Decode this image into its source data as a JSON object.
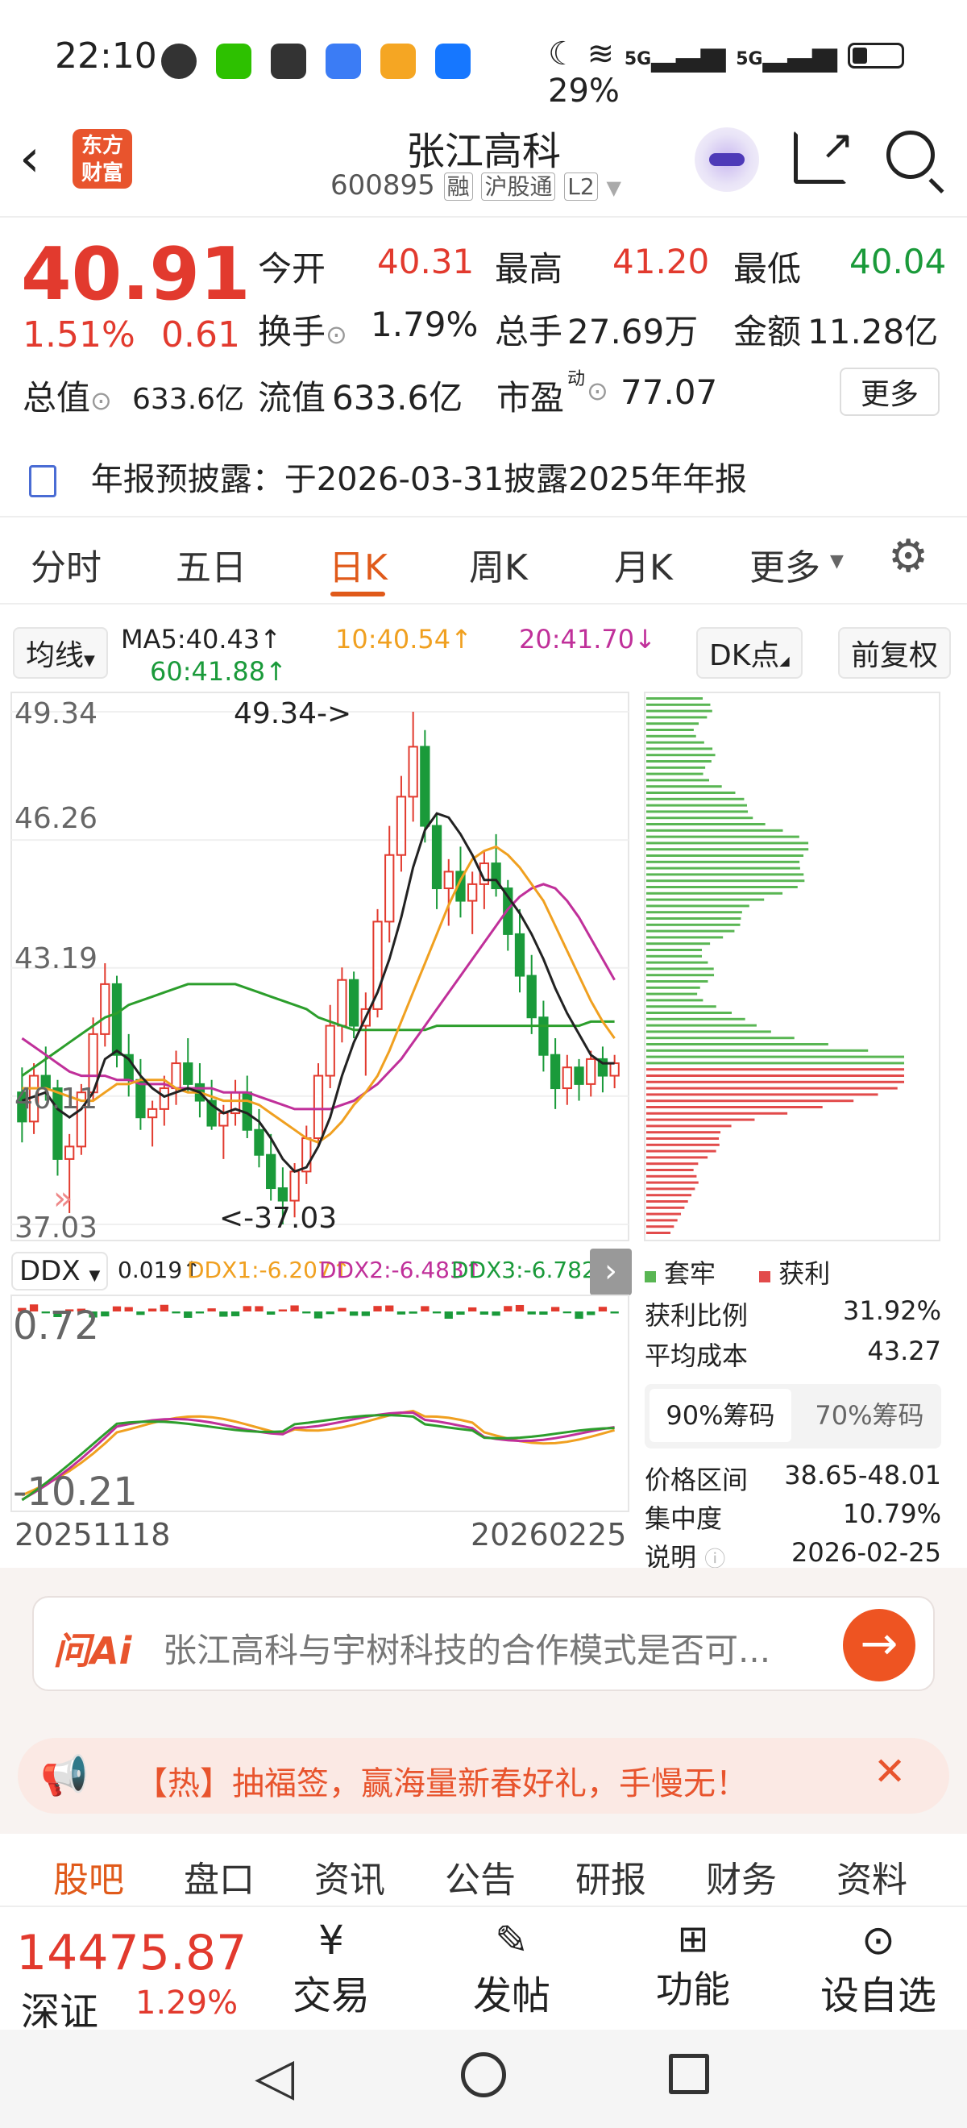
{
  "status": {
    "time": "22:10",
    "signal1": "5G",
    "signal2": "5G",
    "battery": "29%"
  },
  "header": {
    "logo_line1": "东方",
    "logo_line2": "财富",
    "stock_name": "张江高科",
    "code": "600895",
    "tag1": "融",
    "tag2": "沪股通",
    "tag3": "L2"
  },
  "quote": {
    "price": "40.91",
    "pct": "1.51%",
    "change": "0.61",
    "open_label": "今开",
    "open": "40.31",
    "high_label": "最高",
    "high": "41.20",
    "low_label": "最低",
    "low": "40.04",
    "turnover_label": "换手",
    "turnover": "1.79%",
    "vol_label": "总手",
    "vol": "27.69万",
    "amount_label": "金额",
    "amount": "11.28亿",
    "mcap_label": "总值",
    "mcap": "633.6亿",
    "float_label": "流值",
    "float": "633.6亿",
    "pe_label": "市盈",
    "pe_sup": "动",
    "pe": "77.07",
    "more": "更多",
    "notice": "年报预披露：于2026-03-31披露2025年年报"
  },
  "tabs": [
    {
      "label": "分时"
    },
    {
      "label": "五日"
    },
    {
      "label": "日K"
    },
    {
      "label": "周K"
    },
    {
      "label": "月K"
    },
    {
      "label": "更多"
    }
  ],
  "kline_bar": {
    "indicator": "均线",
    "ma5": "MA5:40.43↑",
    "ma10": "10:40.54↑",
    "ma20": "20:41.70↓",
    "ma60": "60:41.88↑",
    "dk": "DK点",
    "fq": "前复权"
  },
  "axis": {
    "y1": "49.34",
    "y2": "46.26",
    "y3": "43.19",
    "y4": "40.11",
    "y5": "37.03",
    "max_label": "49.34->",
    "min_label": "<-37.03",
    "date_start": "20251118",
    "date_end": "20260225"
  },
  "ddx": {
    "name": "DDX",
    "v0": "0.019↑",
    "v1": "DDX1:-6.207↑",
    "v2": "DDX2:-6.483↑",
    "v3": "DDX3:-6.782↑",
    "top": "0.72",
    "bottom": "-10.21"
  },
  "chips": {
    "legend1": "套牢",
    "legend2": "获利",
    "profit_label": "获利比例",
    "profit": "31.92%",
    "avg_label": "平均成本",
    "avg": "43.27",
    "tab90": "90%筹码",
    "tab70": "70%筹码",
    "range_label": "价格区间",
    "range": "38.65-48.01",
    "conc_label": "集中度",
    "conc": "10.79%",
    "note_label": "说明",
    "date": "2026-02-25"
  },
  "ai": {
    "brand": "问Ai",
    "prompt": "张江高科与宇树科技的合作模式是否可..."
  },
  "promo": {
    "text": "【热】抽福签，赢海量新春好礼，手慢无！"
  },
  "subtabs": [
    {
      "label": "股吧"
    },
    {
      "label": "盘口"
    },
    {
      "label": "资讯"
    },
    {
      "label": "公告"
    },
    {
      "label": "研报"
    },
    {
      "label": "财务"
    },
    {
      "label": "资料"
    }
  ],
  "bottom": {
    "index_value": "14475.87",
    "index_name": "深证",
    "index_pct": "1.29%",
    "trade": "交易",
    "post": "发帖",
    "func": "功能",
    "watch": "设自选"
  },
  "chart_data": {
    "type": "candlestick",
    "ylim": [
      37.03,
      49.34
    ],
    "yticks": [
      49.34,
      46.26,
      43.19,
      40.11,
      37.03
    ],
    "x_start": "20251118",
    "x_end": "20260225",
    "ohlc": [
      [
        40.2,
        40.8,
        39.0,
        39.5
      ],
      [
        39.5,
        40.9,
        39.2,
        40.6
      ],
      [
        40.6,
        41.3,
        40.0,
        40.3
      ],
      [
        40.3,
        40.5,
        38.2,
        38.6
      ],
      [
        38.6,
        39.2,
        37.3,
        38.9
      ],
      [
        38.9,
        40.4,
        38.7,
        40.2
      ],
      [
        40.2,
        42.0,
        40.0,
        41.6
      ],
      [
        41.6,
        43.3,
        41.3,
        42.8
      ],
      [
        42.8,
        43.0,
        40.8,
        41.1
      ],
      [
        41.1,
        41.6,
        40.1,
        40.5
      ],
      [
        40.5,
        41.0,
        39.3,
        39.6
      ],
      [
        39.6,
        40.0,
        38.9,
        39.8
      ],
      [
        39.8,
        40.6,
        39.4,
        40.3
      ],
      [
        40.3,
        41.2,
        39.9,
        40.9
      ],
      [
        40.9,
        41.5,
        40.2,
        40.4
      ],
      [
        40.4,
        40.9,
        39.6,
        40.0
      ],
      [
        40.0,
        40.5,
        39.3,
        39.4
      ],
      [
        39.4,
        39.9,
        38.6,
        39.7
      ],
      [
        39.7,
        40.5,
        39.4,
        40.2
      ],
      [
        40.2,
        40.6,
        39.1,
        39.3
      ],
      [
        39.3,
        39.8,
        38.4,
        38.7
      ],
      [
        38.7,
        39.2,
        37.6,
        37.9
      ],
      [
        37.9,
        38.4,
        37.03,
        37.6
      ],
      [
        37.6,
        38.5,
        37.2,
        38.3
      ],
      [
        38.3,
        39.4,
        38.0,
        39.1
      ],
      [
        39.1,
        40.9,
        38.9,
        40.6
      ],
      [
        40.6,
        42.3,
        40.3,
        41.8
      ],
      [
        41.8,
        43.2,
        41.4,
        42.9
      ],
      [
        42.9,
        43.1,
        41.5,
        41.8
      ],
      [
        41.8,
        42.6,
        40.6,
        42.2
      ],
      [
        42.2,
        44.6,
        42.0,
        44.3
      ],
      [
        44.3,
        46.6,
        43.8,
        45.9
      ],
      [
        45.9,
        47.8,
        45.5,
        47.3
      ],
      [
        47.3,
        49.34,
        46.7,
        48.5
      ],
      [
        48.5,
        48.9,
        46.2,
        46.6
      ],
      [
        46.6,
        46.9,
        44.6,
        45.1
      ],
      [
        45.1,
        45.8,
        44.2,
        45.5
      ],
      [
        45.5,
        46.1,
        44.4,
        44.8
      ],
      [
        44.8,
        45.5,
        44.0,
        45.2
      ],
      [
        45.2,
        46.0,
        44.6,
        45.7
      ],
      [
        45.7,
        46.4,
        44.9,
        45.1
      ],
      [
        45.1,
        45.3,
        43.6,
        44.0
      ],
      [
        44.0,
        44.6,
        42.6,
        43.0
      ],
      [
        43.0,
        43.5,
        41.6,
        42.0
      ],
      [
        42.0,
        42.4,
        40.7,
        41.1
      ],
      [
        41.1,
        41.5,
        39.8,
        40.3
      ],
      [
        40.3,
        41.1,
        39.9,
        40.8
      ],
      [
        40.8,
        41.0,
        40.0,
        40.4
      ],
      [
        40.4,
        41.2,
        40.1,
        41.0
      ],
      [
        41.0,
        41.3,
        40.2,
        40.6
      ],
      [
        40.6,
        41.1,
        40.3,
        40.9
      ]
    ],
    "ma5": [
      40.0,
      40.1,
      40.2,
      39.8,
      39.6,
      39.8,
      40.2,
      41.0,
      41.2,
      41.0,
      40.6,
      40.3,
      40.1,
      40.2,
      40.3,
      40.2,
      39.9,
      39.7,
      39.8,
      39.7,
      39.5,
      39.1,
      38.6,
      38.3,
      38.4,
      38.9,
      39.6,
      40.6,
      41.4,
      42.0,
      42.6,
      43.4,
      44.4,
      45.6,
      46.5,
      46.9,
      46.8,
      46.4,
      45.9,
      45.3,
      45.3,
      44.9,
      44.5,
      44.0,
      43.4,
      42.7,
      42.1,
      41.6,
      41.1,
      40.9,
      40.9
    ],
    "ma10": [
      40.3,
      40.3,
      40.3,
      40.2,
      40.1,
      40.0,
      40.0,
      40.2,
      40.4,
      40.4,
      40.5,
      40.5,
      40.5,
      40.3,
      40.2,
      40.2,
      40.1,
      40.0,
      40.0,
      40.0,
      39.9,
      39.7,
      39.5,
      39.3,
      39.1,
      39.0,
      39.2,
      39.5,
      39.9,
      40.2,
      40.6,
      41.2,
      41.9,
      42.6,
      43.3,
      44.0,
      44.7,
      45.3,
      45.8,
      46.0,
      46.1,
      45.9,
      45.6,
      45.2,
      44.8,
      44.2,
      43.6,
      43.0,
      42.4,
      41.9,
      41.5
    ],
    "ma20": [
      41.5,
      41.3,
      41.1,
      40.9,
      40.7,
      40.6,
      40.6,
      40.6,
      40.5,
      40.5,
      40.4,
      40.4,
      40.4,
      40.3,
      40.3,
      40.3,
      40.3,
      40.2,
      40.2,
      40.2,
      40.1,
      40.0,
      39.9,
      39.8,
      39.8,
      39.8,
      39.8,
      39.9,
      40.0,
      40.2,
      40.4,
      40.7,
      41.0,
      41.4,
      41.8,
      42.2,
      42.6,
      43.0,
      43.4,
      43.8,
      44.2,
      44.6,
      44.9,
      45.1,
      45.2,
      45.1,
      44.8,
      44.4,
      43.9,
      43.4,
      42.9
    ],
    "ma60": [
      40.6,
      40.8,
      41.0,
      41.2,
      41.4,
      41.6,
      41.8,
      42.0,
      42.1,
      42.3,
      42.4,
      42.5,
      42.6,
      42.7,
      42.8,
      42.8,
      42.8,
      42.8,
      42.8,
      42.7,
      42.6,
      42.5,
      42.4,
      42.3,
      42.2,
      42.0,
      41.9,
      41.8,
      41.7,
      41.7,
      41.7,
      41.7,
      41.7,
      41.7,
      41.7,
      41.8,
      41.8,
      41.8,
      41.8,
      41.8,
      41.8,
      41.8,
      41.8,
      41.8,
      41.8,
      41.8,
      41.8,
      41.8,
      41.9,
      41.9,
      41.9
    ]
  }
}
